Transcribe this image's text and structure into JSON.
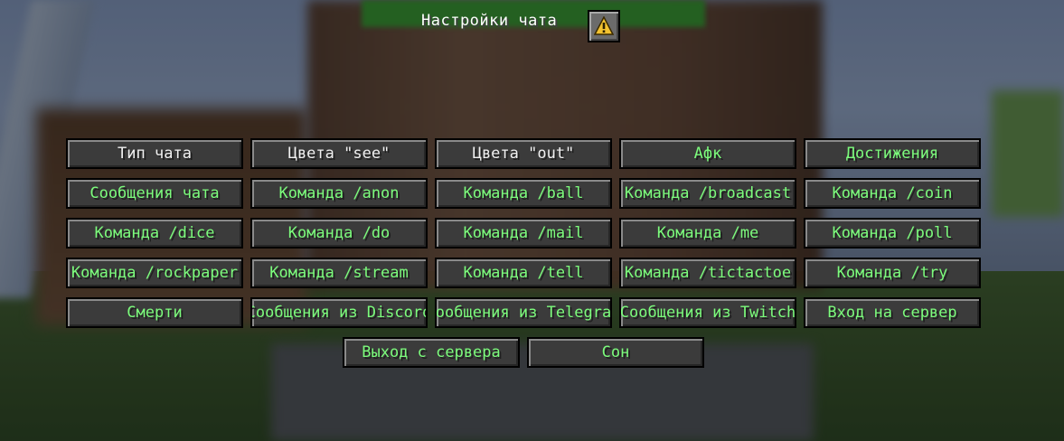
{
  "header": {
    "title": "Настройки чата",
    "warning_icon": "warning-icon"
  },
  "colors": {
    "text_white": "#f0f0f0",
    "text_green": "#7cfc7c",
    "button_bg": "#3b3b3b",
    "warning_yellow": "#f2c230"
  },
  "buttons": [
    {
      "label": "Тип чата",
      "color": "white"
    },
    {
      "label": "Цвета \"see\"",
      "color": "white"
    },
    {
      "label": "Цвета \"out\"",
      "color": "white"
    },
    {
      "label": "Афк",
      "color": "green"
    },
    {
      "label": "Достижения",
      "color": "green"
    },
    {
      "label": "Сообщения чата",
      "color": "green"
    },
    {
      "label": "Команда /anon",
      "color": "green"
    },
    {
      "label": "Команда /ball",
      "color": "green"
    },
    {
      "label": "Команда /broadcast",
      "color": "green"
    },
    {
      "label": "Команда /coin",
      "color": "green"
    },
    {
      "label": "Команда /dice",
      "color": "green"
    },
    {
      "label": "Команда /do",
      "color": "green"
    },
    {
      "label": "Команда /mail",
      "color": "green"
    },
    {
      "label": "Команда /me",
      "color": "green"
    },
    {
      "label": "Команда /poll",
      "color": "green"
    },
    {
      "label": "Команда /rockpaper",
      "color": "green"
    },
    {
      "label": "Команда /stream",
      "color": "green"
    },
    {
      "label": "Команда /tell",
      "color": "green"
    },
    {
      "label": "Команда /tictactoe",
      "color": "green"
    },
    {
      "label": "Команда /try",
      "color": "green"
    },
    {
      "label": "Смерти",
      "color": "green"
    },
    {
      "label": "Сообщения из Discord",
      "color": "green"
    },
    {
      "label": "Сообщения из Telegram",
      "color": "green"
    },
    {
      "label": "Сообщения из Twitch",
      "color": "green"
    },
    {
      "label": "Вход на сервер",
      "color": "green"
    },
    {
      "label": "Выход с сервера",
      "color": "green"
    },
    {
      "label": "Сон",
      "color": "green"
    }
  ]
}
